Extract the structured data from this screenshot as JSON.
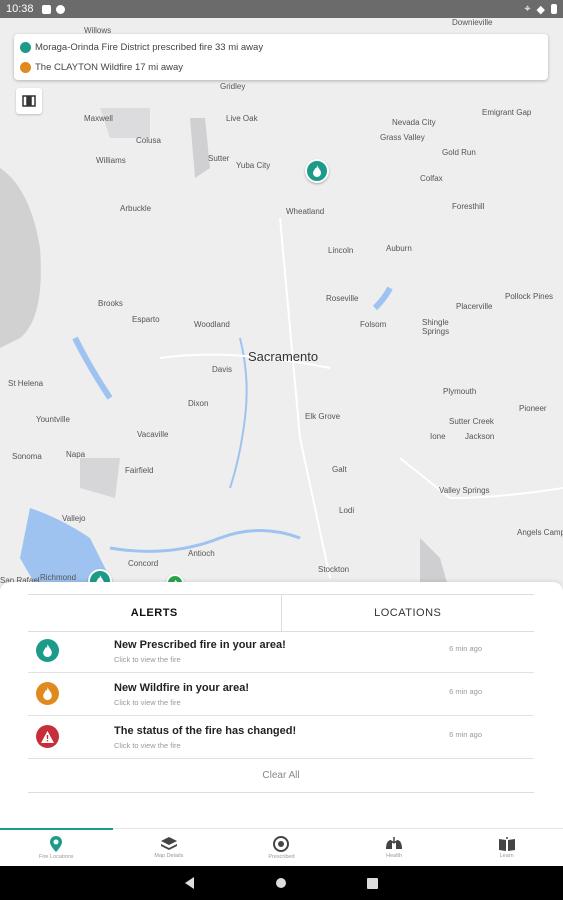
{
  "status_bar": {
    "time": "10:38"
  },
  "map": {
    "labels": [
      {
        "text": "Willows",
        "cls": ""
      },
      {
        "text": "Downieville",
        "cls": ""
      },
      {
        "text": "Gridley",
        "cls": ""
      },
      {
        "text": "Maxwell",
        "cls": ""
      },
      {
        "text": "Live Oak",
        "cls": ""
      },
      {
        "text": "Nevada City",
        "cls": ""
      },
      {
        "text": "Emigrant Gap",
        "cls": ""
      },
      {
        "text": "Colusa",
        "cls": ""
      },
      {
        "text": "Grass Valley",
        "cls": ""
      },
      {
        "text": "Williams",
        "cls": ""
      },
      {
        "text": "Sutter",
        "cls": ""
      },
      {
        "text": "Yuba City",
        "cls": ""
      },
      {
        "text": "Gold Run",
        "cls": ""
      },
      {
        "text": "Colfax",
        "cls": ""
      },
      {
        "text": "Arbuckle",
        "cls": ""
      },
      {
        "text": "Wheatland",
        "cls": ""
      },
      {
        "text": "Foresthill",
        "cls": ""
      },
      {
        "text": "Lincoln",
        "cls": ""
      },
      {
        "text": "Auburn",
        "cls": ""
      },
      {
        "text": "Pollock Pines",
        "cls": ""
      },
      {
        "text": "Roseville",
        "cls": ""
      },
      {
        "text": "Placerville",
        "cls": ""
      },
      {
        "text": "Brooks",
        "cls": ""
      },
      {
        "text": "Esparto",
        "cls": ""
      },
      {
        "text": "Woodland",
        "cls": ""
      },
      {
        "text": "Folsom",
        "cls": ""
      },
      {
        "text": "Shingle Springs",
        "cls": ""
      },
      {
        "text": "Sacramento",
        "cls": "big"
      },
      {
        "text": "Davis",
        "cls": ""
      },
      {
        "text": "St Helena",
        "cls": ""
      },
      {
        "text": "Plymouth",
        "cls": ""
      },
      {
        "text": "Dixon",
        "cls": ""
      },
      {
        "text": "Elk Grove",
        "cls": ""
      },
      {
        "text": "Pioneer",
        "cls": ""
      },
      {
        "text": "Yountville",
        "cls": ""
      },
      {
        "text": "Sutter Creek",
        "cls": ""
      },
      {
        "text": "Vacaville",
        "cls": ""
      },
      {
        "text": "Ione",
        "cls": ""
      },
      {
        "text": "Jackson",
        "cls": ""
      },
      {
        "text": "Sonoma",
        "cls": ""
      },
      {
        "text": "Napa",
        "cls": ""
      },
      {
        "text": "Fairfield",
        "cls": ""
      },
      {
        "text": "Galt",
        "cls": ""
      },
      {
        "text": "Valley Springs",
        "cls": ""
      },
      {
        "text": "Lodi",
        "cls": ""
      },
      {
        "text": "Vallejo",
        "cls": ""
      },
      {
        "text": "Angels Camp",
        "cls": ""
      },
      {
        "text": "Antioch",
        "cls": ""
      },
      {
        "text": "Concord",
        "cls": ""
      },
      {
        "text": "Richmond",
        "cls": ""
      },
      {
        "text": "Stockton",
        "cls": ""
      },
      {
        "text": "San Rafael",
        "cls": ""
      }
    ],
    "notifications": [
      {
        "text": "Moraga-Orinda Fire District prescribed fire 33 mi away",
        "color": "#1d9b8a"
      },
      {
        "text": "The CLAYTON Wildfire 17 mi away",
        "color": "#e08a1e"
      }
    ]
  },
  "panel": {
    "tabs": [
      "ALERTS",
      "LOCATIONS"
    ],
    "alerts": [
      {
        "title": "New Prescribed fire in your area!",
        "subtitle": "Click to view the fire",
        "time": "6 min ago",
        "color": "#1d9b8a",
        "icon": "flame-icon"
      },
      {
        "title": "New Wildfire in your area!",
        "subtitle": "Click to view the fire",
        "time": "6 min ago",
        "color": "#e08a1e",
        "icon": "flame-icon"
      },
      {
        "title": "The status of the fire has changed!",
        "subtitle": "Click to view the fire",
        "time": "6 min ago",
        "color": "#c62f3a",
        "icon": "warning-icon"
      }
    ],
    "clear_all": "Clear All"
  },
  "bottom_nav": [
    {
      "label": "Fire Locations",
      "icon": "location-icon",
      "active": true
    },
    {
      "label": "Map Details",
      "icon": "layers-icon",
      "active": false
    },
    {
      "label": "Prescribed",
      "icon": "burn-icon",
      "active": false
    },
    {
      "label": "Health",
      "icon": "lungs-icon",
      "active": false
    },
    {
      "label": "Learn",
      "icon": "book-icon",
      "active": false
    }
  ],
  "colors": {
    "accent": "#1d9b8a",
    "wildfire": "#e08a1e",
    "alert": "#c62f3a"
  }
}
